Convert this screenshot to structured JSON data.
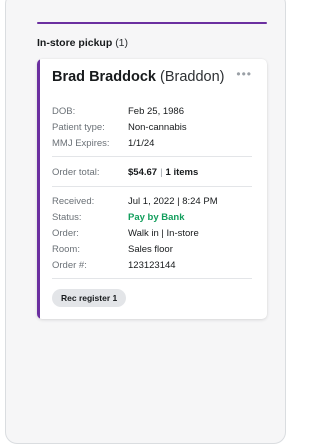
{
  "section": {
    "title": "In-store pickup",
    "count": "(1)"
  },
  "order": {
    "name": "Brad Braddock",
    "nickname": "(Braddon)",
    "more_icon": "more-horizontal-icon",
    "dob_label": "DOB:",
    "dob": "Feb 25, 1986",
    "patient_type_label": "Patient type:",
    "patient_type": "Non-cannabis",
    "mmj_label": "MMJ Expires:",
    "mmj": "1/1/24",
    "total_label": "Order total:",
    "total": "$54.67",
    "total_sep": "|",
    "items": "1 items",
    "received_label": "Received:",
    "received": "Jul 1, 2022 | 8:24 PM",
    "status_label": "Status:",
    "status": "Pay by Bank",
    "order_label": "Order:",
    "order_type": "Walk in | In-store",
    "room_label": "Room:",
    "room": "Sales floor",
    "order_num_label": "Order #:",
    "order_num": "123123144",
    "register": "Rec register 1"
  },
  "colors": {
    "accent": "#6b2fa0",
    "status_green": "#129e5c"
  }
}
